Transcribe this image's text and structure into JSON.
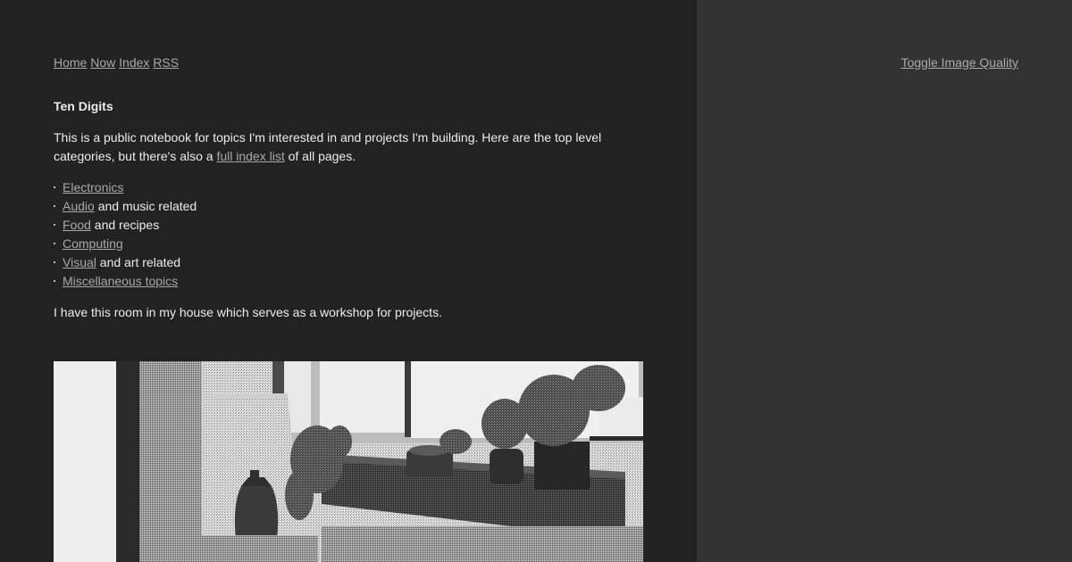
{
  "nav": {
    "links": [
      {
        "label": "Home"
      },
      {
        "label": "Now"
      },
      {
        "label": "Index"
      },
      {
        "label": "RSS"
      }
    ]
  },
  "toggle_label": "Toggle Image Quality",
  "page": {
    "title": "Ten Digits",
    "intro_text_1": "This is a public notebook for topics I'm interested in and projects I'm building. Here are the top level categories, but there's also a ",
    "intro_link": "full index list",
    "intro_text_2": " of all pages.",
    "categories": [
      {
        "link": "Electronics",
        "suffix": ""
      },
      {
        "link": "Audio",
        "suffix": " and music related"
      },
      {
        "link": "Food",
        "suffix": " and recipes"
      },
      {
        "link": "Computing",
        "suffix": ""
      },
      {
        "link": "Visual",
        "suffix": " and art related"
      },
      {
        "link": "Miscellaneous topics",
        "suffix": ""
      }
    ],
    "workshop_text": "I have this room in my house which serves as a workshop for projects."
  },
  "colors": {
    "main_bg": "#222222",
    "side_bg": "#333333",
    "text": "#ececec",
    "link": "#a9a9a9"
  }
}
